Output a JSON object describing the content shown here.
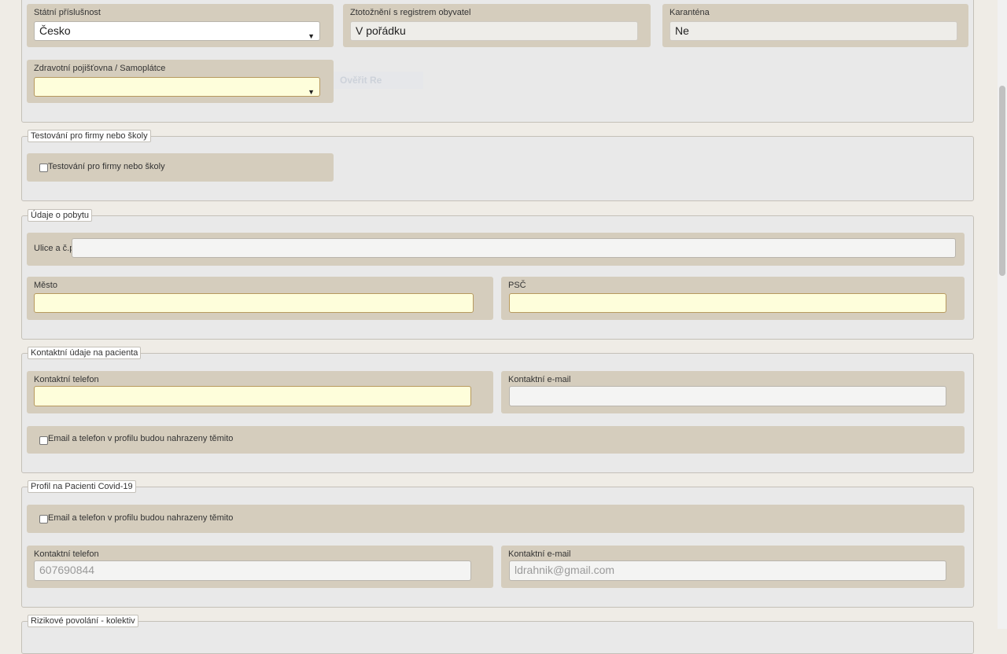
{
  "top": {
    "statni_prislusnost": {
      "label": "Státní příslušnost",
      "value": "Česko"
    },
    "ztotozneni": {
      "label": "Ztotožnění s registrem obyvatel",
      "value": "V pořádku"
    },
    "karantena": {
      "label": "Karanténa",
      "value": "Ne"
    },
    "pojistovna": {
      "label": "Zdravotní pojišťovna / Samoplátce",
      "value": ""
    },
    "ghost_button": "Ověřit Re"
  },
  "testovani": {
    "legend": "Testování pro firmy nebo školy",
    "checkbox_label": "Testování pro firmy nebo školy"
  },
  "pobyt": {
    "legend": "Údaje o pobytu",
    "ulice": {
      "label": "Ulice a č.p.",
      "value": ""
    },
    "mesto": {
      "label": "Město",
      "value": ""
    },
    "psc": {
      "label": "PSČ",
      "value": ""
    }
  },
  "kontakt": {
    "legend": "Kontaktní údaje na pacienta",
    "telefon": {
      "label": "Kontaktní telefon",
      "value": ""
    },
    "email": {
      "label": "Kontaktní e-mail",
      "value": ""
    },
    "checkbox_label": "Email a telefon v profilu budou nahrazeny těmito"
  },
  "profil": {
    "legend": "Profil na Pacienti Covid-19",
    "checkbox_label": "Email a telefon v profilu budou nahrazeny těmito",
    "telefon": {
      "label": "Kontaktní telefon",
      "placeholder": "607690844"
    },
    "email": {
      "label": "Kontaktní e-mail",
      "placeholder": "ldrahnik@gmail.com"
    }
  },
  "rizikove": {
    "legend": "Rizikové povolání - kolektiv"
  },
  "icons": {
    "select_arrow": "chevron-down-icon"
  }
}
